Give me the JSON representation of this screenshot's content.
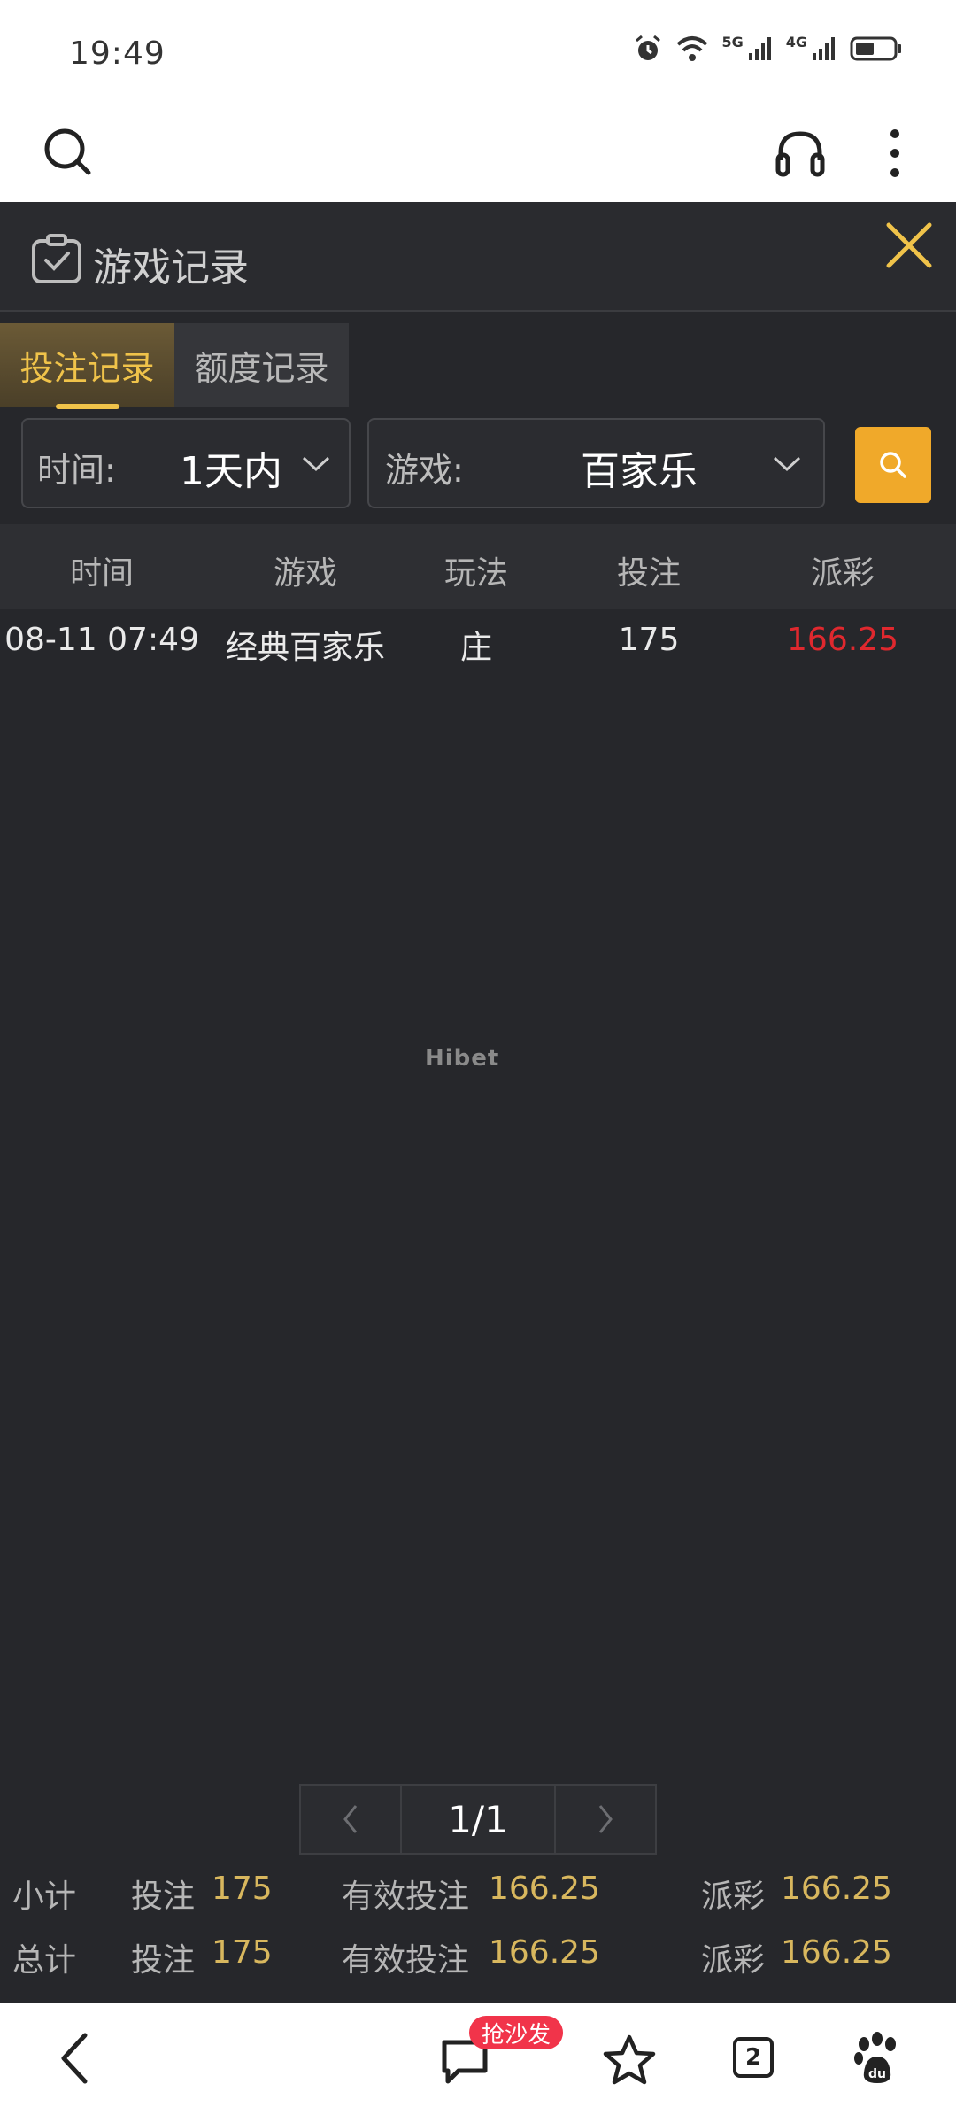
{
  "status_bar": {
    "time": "19:49",
    "network_1": "5G",
    "network_2": "4G"
  },
  "modal": {
    "title": "游戏记录"
  },
  "tabs": [
    {
      "label": "投注记录",
      "active": true
    },
    {
      "label": "额度记录",
      "active": false
    }
  ],
  "filters": {
    "time_label": "时间:",
    "time_value": "1天内",
    "game_label": "游戏:",
    "game_value": "百家乐"
  },
  "table": {
    "headers": [
      "时间",
      "游戏",
      "玩法",
      "投注",
      "派彩"
    ],
    "rows": [
      [
        "08-11 07:49",
        "经典百家乐",
        "庄",
        "175",
        "166.25"
      ]
    ]
  },
  "watermark": "Hibet",
  "pagination": {
    "page": "1/1"
  },
  "summary": {
    "subtotal": {
      "label": "小计",
      "bet_label": "投注",
      "bet": "175",
      "valid_label": "有效投注",
      "valid": "166.25",
      "payout_label": "派彩",
      "payout": "166.25"
    },
    "total": {
      "label": "总计",
      "bet_label": "投注",
      "bet": "175",
      "valid_label": "有效投注",
      "valid": "166.25",
      "payout_label": "派彩",
      "payout": "166.25"
    }
  },
  "bottom_nav": {
    "comment_badge": "抢沙发",
    "tab_count": "2"
  },
  "colors": {
    "accent": "#f0a92a",
    "gold_text": "#d8b75e",
    "payout_red": "#e0282e",
    "background": "#26272b"
  }
}
